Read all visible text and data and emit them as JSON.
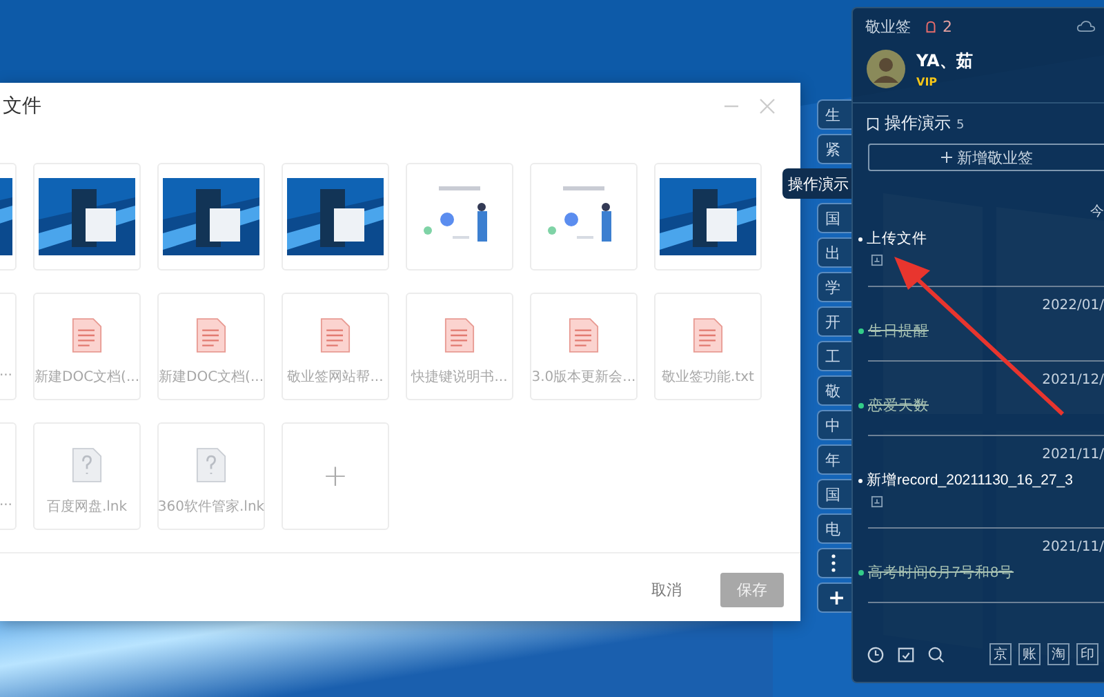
{
  "dialog": {
    "title": "文件",
    "tiles": [
      {
        "kind": "screenshot"
      },
      {
        "kind": "screenshot"
      },
      {
        "kind": "screenshot"
      },
      {
        "kind": "screenshot"
      },
      {
        "kind": "illustration"
      },
      {
        "kind": "illustration"
      },
      {
        "kind": "screenshot"
      },
      {
        "kind": "document",
        "name": "..."
      },
      {
        "kind": "document",
        "name": "新建DOC文档(..."
      },
      {
        "kind": "document",
        "name": "新建DOC文档(..."
      },
      {
        "kind": "document",
        "name": "敬业签网站帮..."
      },
      {
        "kind": "document",
        "name": "快捷键说明书..."
      },
      {
        "kind": "document",
        "name": "3.0版本更新会..."
      },
      {
        "kind": "document",
        "name": "敬业签功能.txt"
      },
      {
        "kind": "shortcut",
        "name": "..."
      },
      {
        "kind": "shortcut",
        "name": "百度网盘.lnk"
      },
      {
        "kind": "shortcut",
        "name": "360软件管家.lnk"
      },
      {
        "kind": "add",
        "label": "+"
      }
    ],
    "buttons": [
      {
        "label": "取消",
        "kind": "plain",
        "disabled": false
      },
      {
        "label": "保存",
        "kind": "primary",
        "disabled": true
      }
    ]
  },
  "tabs": [
    {
      "label": "生",
      "kind": "category",
      "selected": false
    },
    {
      "label": "紧",
      "kind": "category",
      "selected": false
    },
    {
      "label": "操作演示",
      "kind": "category",
      "selected": true
    },
    {
      "label": "国",
      "kind": "category",
      "selected": false
    },
    {
      "label": "出",
      "kind": "category",
      "selected": false
    },
    {
      "label": "学",
      "kind": "category",
      "selected": false
    },
    {
      "label": "开",
      "kind": "category",
      "selected": false
    },
    {
      "label": "工",
      "kind": "category",
      "selected": false
    },
    {
      "label": "敬",
      "kind": "category",
      "selected": false
    },
    {
      "label": "中",
      "kind": "category",
      "selected": false
    },
    {
      "label": "年",
      "kind": "category",
      "selected": false
    },
    {
      "label": "国",
      "kind": "category",
      "selected": false
    },
    {
      "label": "电",
      "kind": "category",
      "selected": false
    },
    {
      "kind": "more",
      "selected": false
    },
    {
      "label": "+",
      "kind": "add",
      "selected": false
    }
  ],
  "panel": {
    "app_name": "敬业签",
    "notification_count": "2",
    "user": {
      "name": "YA、茹",
      "badge": "VIP"
    },
    "folder": {
      "name": "操作演示",
      "count": "5"
    },
    "new_button": "新增敬业签",
    "notes": [
      {
        "date": "今",
        "title": "上传文件",
        "done": false,
        "attachment": true
      },
      {
        "date": "2022/01/",
        "title": "生日提醒",
        "done": true,
        "attachment": false
      },
      {
        "date": "2021/12/",
        "title": "恋爱天数",
        "done": true,
        "attachment": false
      },
      {
        "date": "2021/11/",
        "title": "新增record_20211130_16_27_3",
        "done": false,
        "attachment": true
      },
      {
        "date": "2021/11/",
        "title": "高考时间6月7号和8号",
        "done": true,
        "attachment": false
      }
    ],
    "tools": [
      "京",
      "账",
      "淘",
      "印"
    ]
  }
}
